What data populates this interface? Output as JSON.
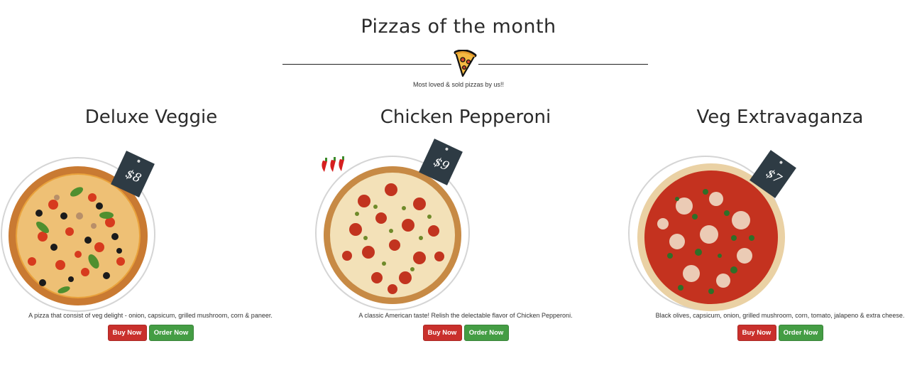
{
  "section": {
    "title": "Pizzas of the month",
    "subtitle": "Most loved & sold pizzas by us!!",
    "divider_icon": "pizza-slice-icon"
  },
  "pizzas": [
    {
      "name": "Deluxe Veggie",
      "price": "$8",
      "description": "A pizza that consist of veg delight - onion, capsicum, grilled mushroom, corn & paneer.",
      "buy_label": "Buy Now",
      "order_label": "Order Now",
      "icon": "pizza-deluxe-veggie-image"
    },
    {
      "name": "Chicken Pepperoni",
      "price": "$9",
      "description": "A classic American taste! Relish the delectable flavor of Chicken Pepperoni.",
      "buy_label": "Buy Now",
      "order_label": "Order Now",
      "icon": "pizza-chicken-pepperoni-image",
      "badge_icon": "chili-peppers-icon"
    },
    {
      "name": "Veg Extravaganza",
      "price": "$7",
      "description": "Black olives, capsicum, onion, grilled mushroom, corn, tomato, jalapeno & extra cheese.",
      "buy_label": "Buy Now",
      "order_label": "Order Now",
      "icon": "pizza-veg-extravaganza-image"
    }
  ],
  "colors": {
    "buy_button": "#c9302c",
    "order_button": "#449d44",
    "price_tag": "#2e3b44"
  }
}
